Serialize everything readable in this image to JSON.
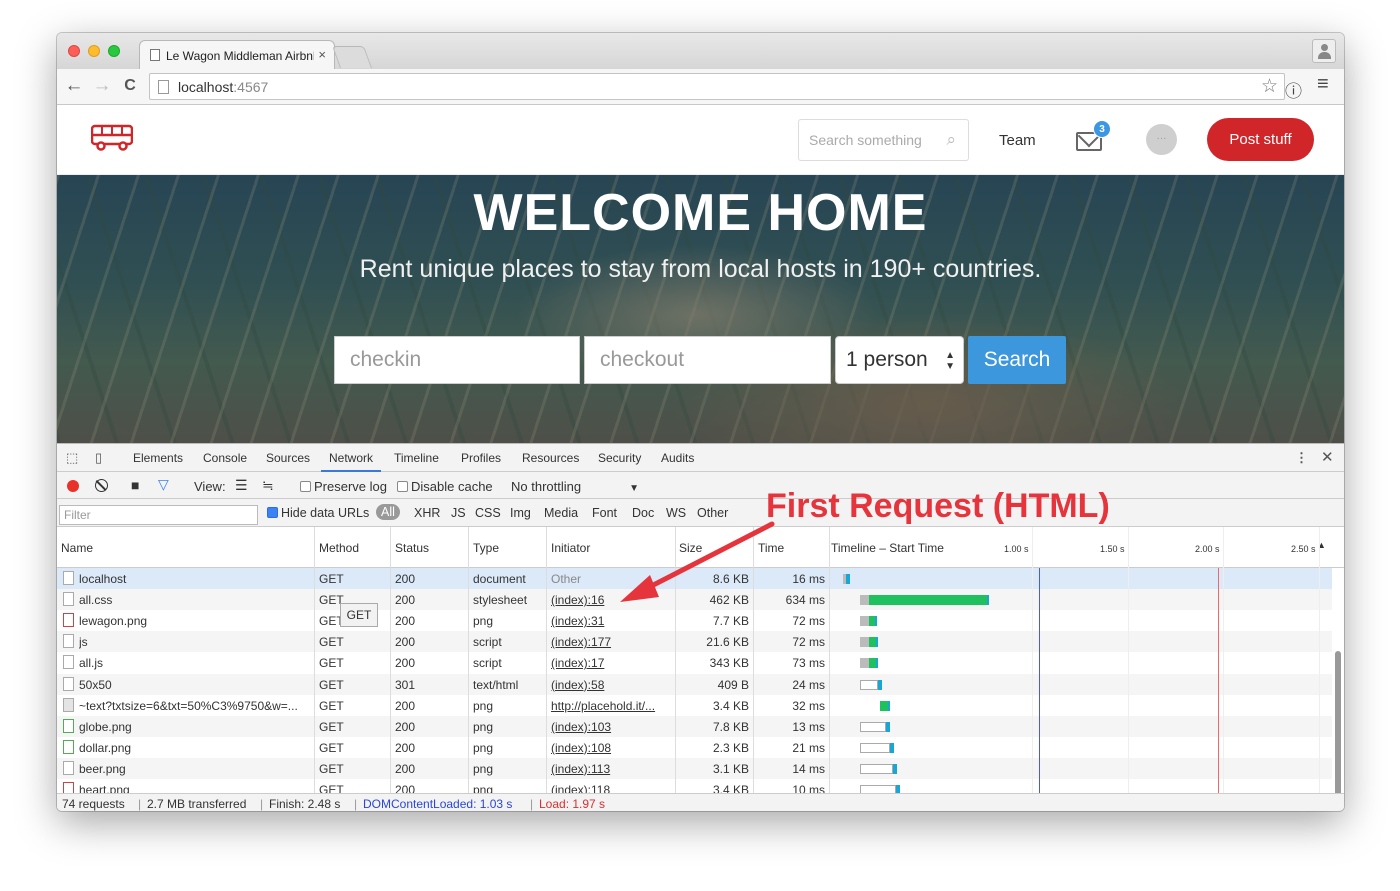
{
  "browser": {
    "tab_title": "Le Wagon Middleman Airbnb",
    "tab_close": "×",
    "url_host": "localhost",
    "url_port": ":4567",
    "back_icon": "←",
    "forward_icon": "→",
    "reload_icon": "C",
    "star_icon": "☆",
    "info_icon": "ⓘ",
    "menu_icon": "≡"
  },
  "navbar": {
    "search_placeholder": "Search something",
    "team": "Team",
    "badge_count": "3",
    "avatar_text": "···",
    "post_button": "Post stuff",
    "logo_color": "#d0262a"
  },
  "hero": {
    "title": "WELCOME HOME",
    "subtitle": "Rent unique places to stay from local hosts in 190+ countries.",
    "checkin_placeholder": "checkin",
    "checkout_placeholder": "checkout",
    "guests_value": "1 person",
    "search_button": "Search"
  },
  "devtools": {
    "tabs": [
      "Elements",
      "Console",
      "Sources",
      "Network",
      "Timeline",
      "Profiles",
      "Resources",
      "Security",
      "Audits"
    ],
    "active_tab": "Network",
    "view_label": "View:",
    "preserve_log": "Preserve log",
    "disable_cache": "Disable cache",
    "throttling": "No throttling",
    "filter_placeholder": "Filter",
    "hide_data_urls": "Hide data URLs",
    "type_filters": [
      "All",
      "XHR",
      "JS",
      "CSS",
      "Img",
      "Media",
      "Font",
      "Doc",
      "WS",
      "Other"
    ],
    "columns": [
      "Name",
      "Method",
      "Status",
      "Type",
      "Initiator",
      "Size",
      "Time",
      "Timeline – Start Time"
    ],
    "timeline_ticks": [
      "1.00 s",
      "1.50 s",
      "2.00 s",
      "2.50 s"
    ],
    "rows": [
      {
        "name": "localhost",
        "method": "GET",
        "status": "200",
        "type": "document",
        "initiator": "Other",
        "size": "8.6 KB",
        "time": "16 ms"
      },
      {
        "name": "all.css",
        "method": "GET",
        "status": "200",
        "type": "stylesheet",
        "initiator": "(index):16",
        "size": "462 KB",
        "time": "634 ms"
      },
      {
        "name": "lewagon.png",
        "method": "GET",
        "status": "200",
        "type": "png",
        "initiator": "(index):31",
        "size": "7.7 KB",
        "time": "72 ms"
      },
      {
        "name": "js",
        "method": "GET",
        "status": "200",
        "type": "script",
        "initiator": "(index):177",
        "size": "21.6 KB",
        "time": "72 ms"
      },
      {
        "name": "all.js",
        "method": "GET",
        "status": "200",
        "type": "script",
        "initiator": "(index):17",
        "size": "343 KB",
        "time": "73 ms"
      },
      {
        "name": "50x50",
        "method": "GET",
        "status": "301",
        "type": "text/html",
        "initiator": "(index):58",
        "size": "409 B",
        "time": "24 ms"
      },
      {
        "name": "~text?txtsize=6&txt=50%C3%9750&w=...",
        "method": "GET",
        "status": "200",
        "type": "png",
        "initiator": "http://placehold.it/...",
        "size": "3.4 KB",
        "time": "32 ms"
      },
      {
        "name": "globe.png",
        "method": "GET",
        "status": "200",
        "type": "png",
        "initiator": "(index):103",
        "size": "7.8 KB",
        "time": "13 ms"
      },
      {
        "name": "dollar.png",
        "method": "GET",
        "status": "200",
        "type": "png",
        "initiator": "(index):108",
        "size": "2.3 KB",
        "time": "21 ms"
      },
      {
        "name": "beer.png",
        "method": "GET",
        "status": "200",
        "type": "png",
        "initiator": "(index):113",
        "size": "3.1 KB",
        "time": "14 ms"
      },
      {
        "name": "heart.png",
        "method": "GET",
        "status": "200",
        "type": "png",
        "initiator": "(index):118",
        "size": "3.4 KB",
        "time": "10 ms"
      }
    ],
    "tooltip": "GET",
    "status_bar": {
      "requests": "74 requests",
      "transferred": "2.7 MB transferred",
      "finish": "Finish: 2.48 s",
      "dom_content_loaded": "DOMContentLoaded: 1.03 s",
      "load": "Load: 1.97 s",
      "separator": "|"
    }
  },
  "annotation": {
    "text": "First Request (HTML)",
    "color": "#e6343c"
  }
}
